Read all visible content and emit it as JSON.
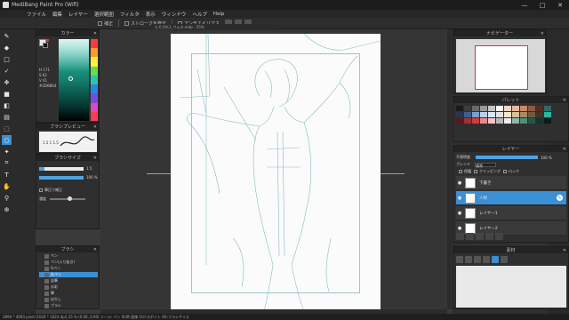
{
  "window": {
    "title": "MediBang Paint Pro (Wifi)",
    "controls": [
      "—",
      "□",
      "✕"
    ]
  },
  "menu": [
    "ファイル",
    "編集",
    "レイヤー",
    "選択範囲",
    "フィルタ",
    "表示",
    "ウィンドウ",
    "ヘルプ",
    "Help"
  ],
  "toolopts": {
    "items": [
      "補正",
      "ストロークを修正",
      "アンチエイリアス"
    ]
  },
  "tools": [
    "pen-icon",
    "eraser-icon",
    "square-icon",
    "check-icon",
    "move-icon",
    "fill-icon",
    "bucket-icon",
    "gradient-icon",
    "select-icon",
    "lasso-icon",
    "wand-icon",
    "crop-icon",
    "text-icon",
    "hand-icon",
    "eyedropper-icon",
    "zoom-icon"
  ],
  "color_panel": {
    "title": "カラー",
    "values": [
      "H 171",
      "S 62",
      "V 41",
      "#2D6B64"
    ]
  },
  "brush_preview": {
    "title": "ブラシプレビュー",
    "label": "1.5 1 1.5"
  },
  "brush_size": {
    "title": "ブラシサイズ",
    "size": "1.5",
    "opacity": "100 %",
    "checkbox": "筆圧で補正",
    "density": "濃度"
  },
  "brush_list": {
    "title": "ブラシ",
    "items": [
      "ペン",
      "ペン(入り抜き)",
      "Gペン",
      "丸ペン",
      "鉛筆",
      "水彩",
      "筆",
      "ぼかし",
      "ブラシ"
    ],
    "selected": 3
  },
  "canvas": {
    "doc_tab": "たそがれ1_サムネ.mdp - 25%"
  },
  "navigator": {
    "title": "ナビゲーター"
  },
  "palette": {
    "title": "パレット"
  },
  "layers": {
    "title": "レイヤー",
    "opacity_label": "不透明度",
    "opacity_value": "100 %",
    "blend_label": "ブレンド",
    "blend_value": "通常",
    "protect_label": "保護",
    "clip_label": "クリッピング",
    "lock_label": "ロック",
    "rows": [
      {
        "name": "下書き",
        "active": false
      },
      {
        "name": "人物",
        "active": true
      },
      {
        "name": "レイヤー1",
        "active": false
      },
      {
        "name": "レイヤー2",
        "active": false
      }
    ]
  },
  "subpanel": {
    "title": "素材"
  },
  "status": {
    "text": "2894 * 4093 pixel  (1024 * 1024 dpi)  25 %  (0.00, 0.00)  ツール: ペン  Shift:直線 Ctrl:スポイト Alt:ブラシサイズ"
  },
  "colors": {
    "accent": "#3b8fd4",
    "teal": "#26b8a0",
    "red": "#d23a3a"
  }
}
